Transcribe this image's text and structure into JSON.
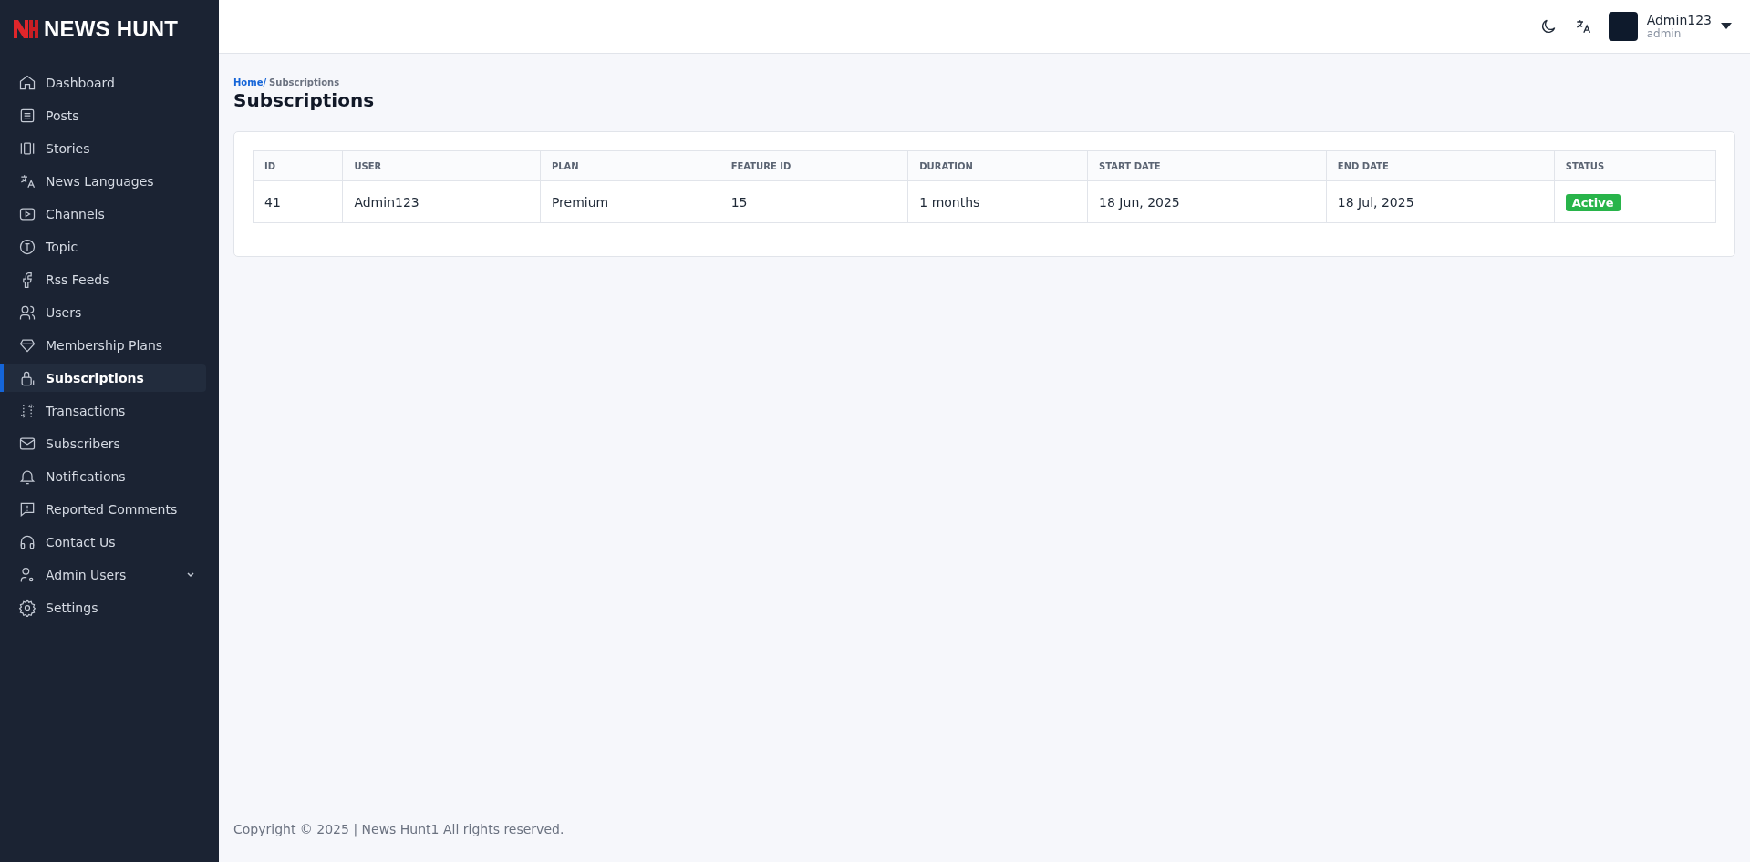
{
  "sidebar": {
    "logo": "NEWS HUNT",
    "items": [
      {
        "label": "Dashboard",
        "kind": "link",
        "selected": false
      },
      {
        "label": "Posts",
        "kind": "link",
        "selected": false
      },
      {
        "label": "Stories",
        "kind": "link",
        "selected": false
      },
      {
        "label": "News Languages",
        "kind": "link",
        "selected": false
      },
      {
        "label": "Channels",
        "kind": "link",
        "selected": false
      },
      {
        "label": "Topic",
        "kind": "link",
        "selected": false
      },
      {
        "label": "Rss Feeds",
        "kind": "link",
        "selected": false
      },
      {
        "label": "Users",
        "kind": "link",
        "selected": false
      },
      {
        "label": "Membership Plans",
        "kind": "link",
        "selected": false
      },
      {
        "label": "Subscriptions",
        "kind": "link",
        "selected": true
      },
      {
        "label": "Transactions",
        "kind": "link",
        "selected": false
      },
      {
        "label": "Subscribers",
        "kind": "link",
        "selected": false
      },
      {
        "label": "Notifications",
        "kind": "link",
        "selected": false
      },
      {
        "label": "Reported Comments",
        "kind": "link",
        "selected": false
      },
      {
        "label": "Contact Us",
        "kind": "link",
        "selected": false
      },
      {
        "label": "Admin Users",
        "kind": "group",
        "selected": false
      },
      {
        "label": "Settings",
        "kind": "link",
        "selected": false
      }
    ]
  },
  "header": {
    "user_name": "Admin123",
    "user_role": "admin"
  },
  "breadcrumb": {
    "home": "Home/",
    "current": "Subscriptions"
  },
  "page_title": "Subscriptions",
  "table": {
    "columns": [
      "ID",
      "USER",
      "PLAN",
      "FEATURE ID",
      "DURATION",
      "START DATE",
      "END DATE",
      "STATUS"
    ],
    "rows": [
      {
        "cells": [
          "41",
          "Admin123",
          "Premium",
          "15",
          "1 months",
          "18 Jun, 2025",
          "18 Jul, 2025"
        ],
        "status": "Active",
        "color": "#28b44a"
      }
    ]
  },
  "footer": "Copyright © 2025 | News Hunt1 All rights reserved."
}
